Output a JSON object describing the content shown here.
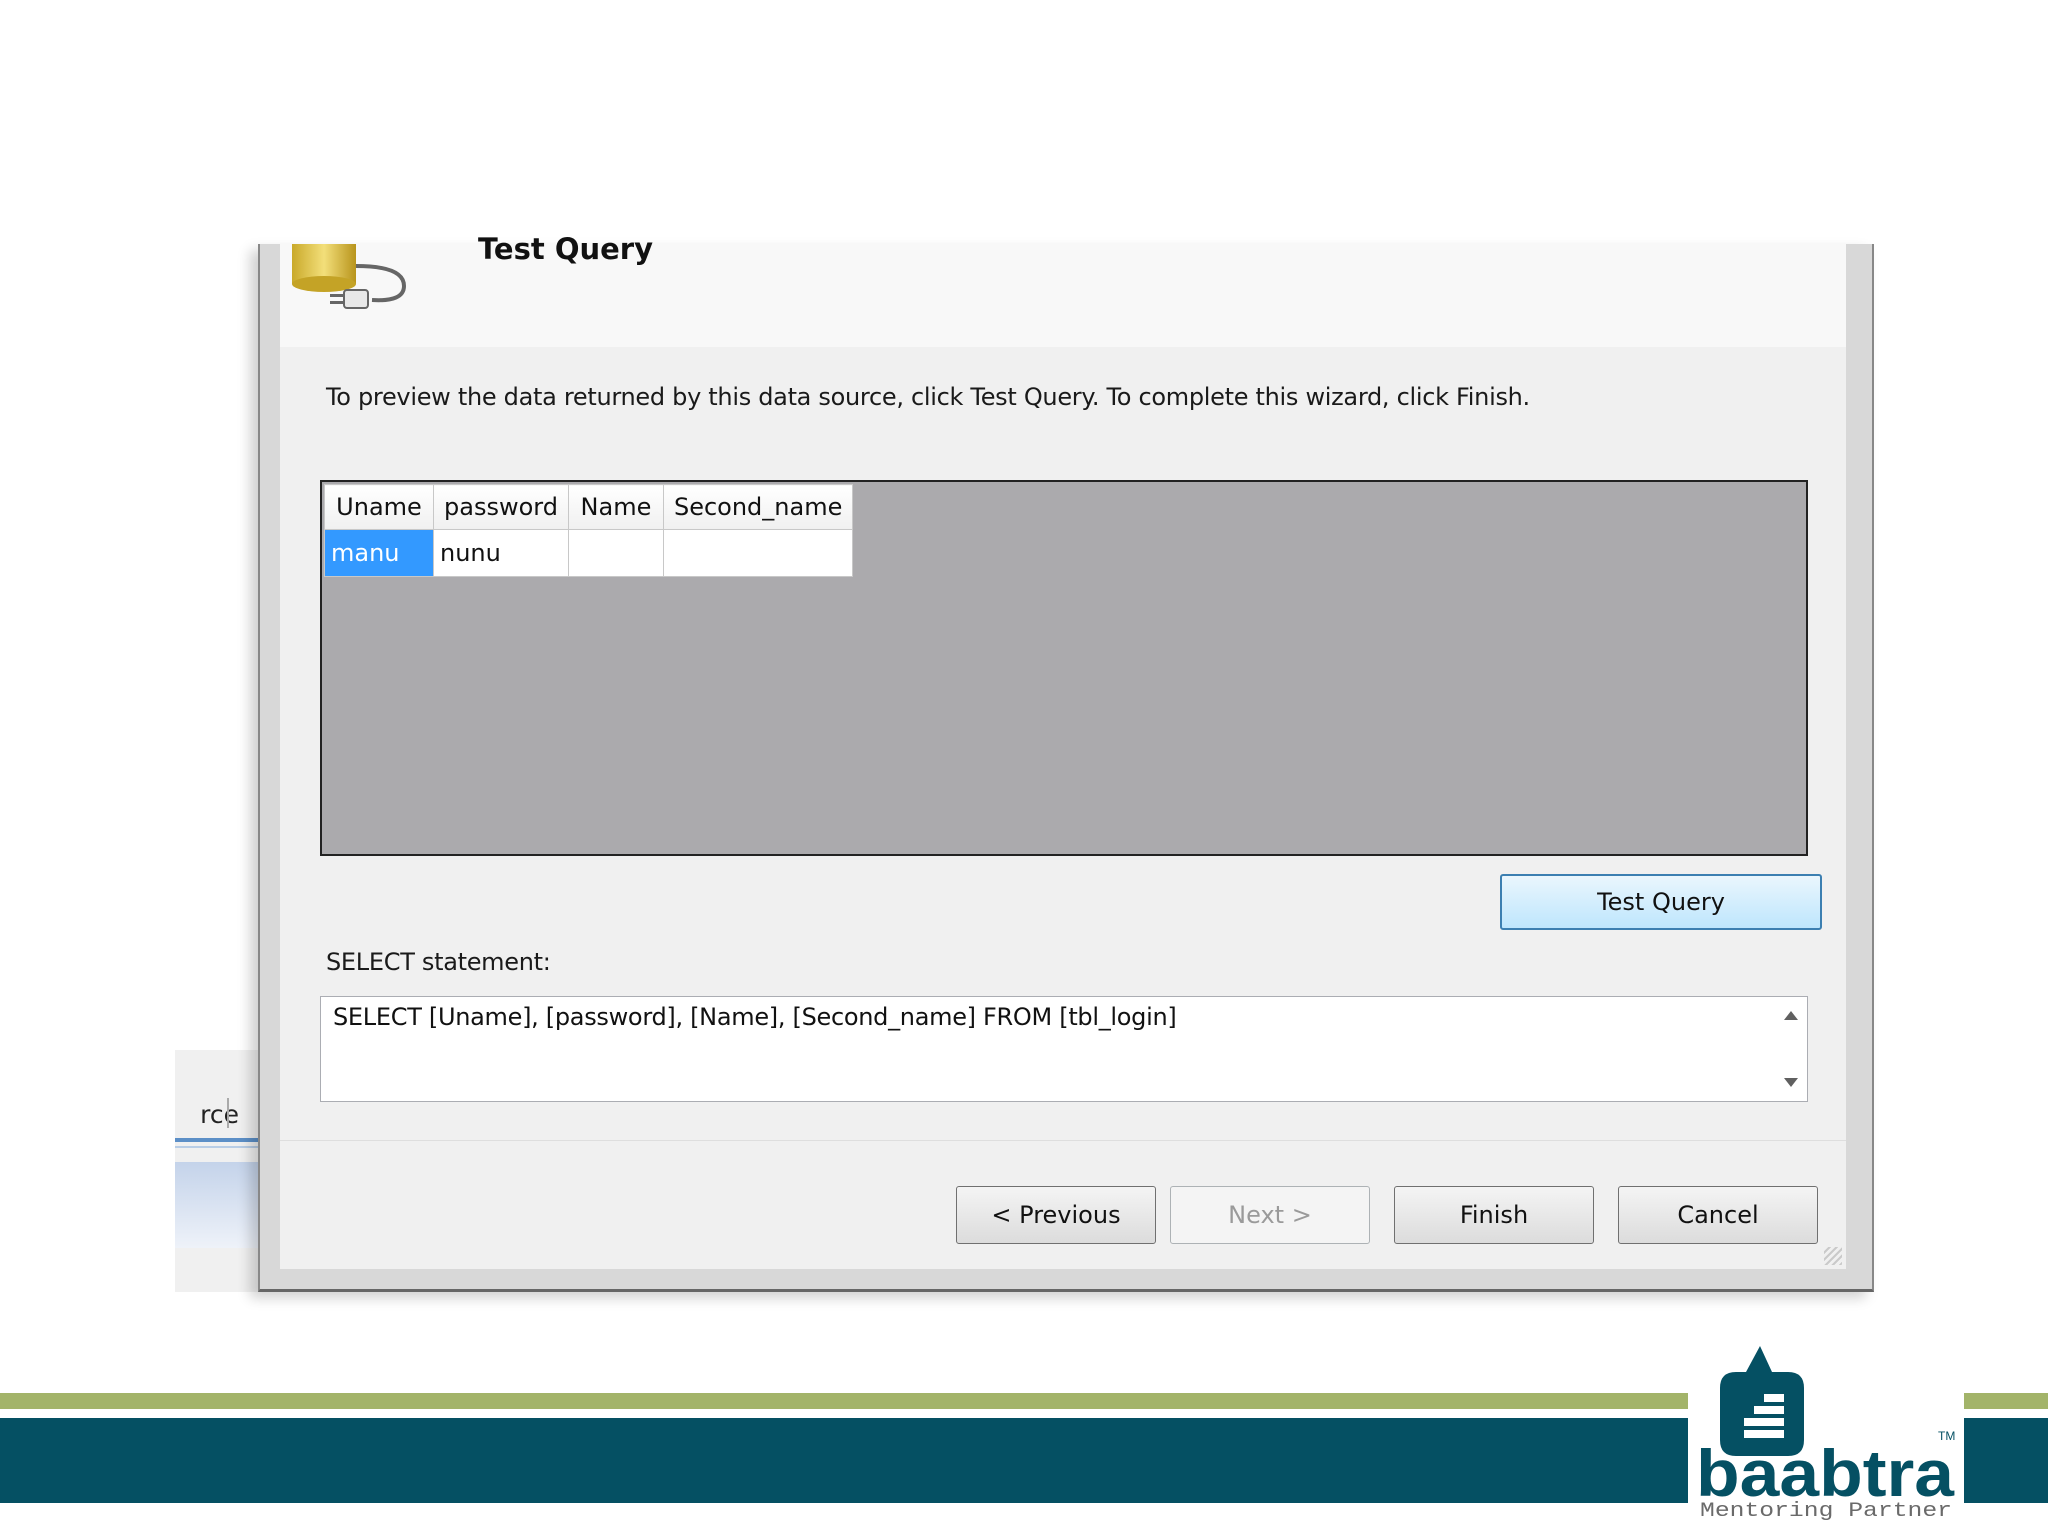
{
  "background_window": {
    "tab_fragment": "rce"
  },
  "dialog": {
    "header_title": "Test Query",
    "instruction": "To preview the data returned by this data source, click Test Query. To complete this wizard, click Finish.",
    "grid": {
      "columns": [
        "Uname",
        "password",
        "Name",
        "Second_name"
      ],
      "rows": [
        [
          "manu",
          "nunu",
          "",
          ""
        ]
      ]
    },
    "test_query_button": "Test Query",
    "select_label": "SELECT statement:",
    "select_statement": "SELECT [Uname], [password], [Name], [Second_name] FROM [tbl_login]",
    "buttons": {
      "previous": "< Previous",
      "next": "Next >",
      "finish": "Finish",
      "cancel": "Cancel"
    }
  },
  "branding": {
    "logo_word": "baabtra",
    "logo_tagline": "Mentoring Partner",
    "trademark": "TM",
    "colors": {
      "teal": "#055063",
      "lime": "#a3b46a",
      "selection": "#3399ff",
      "grid_bg": "#abaaad"
    }
  }
}
